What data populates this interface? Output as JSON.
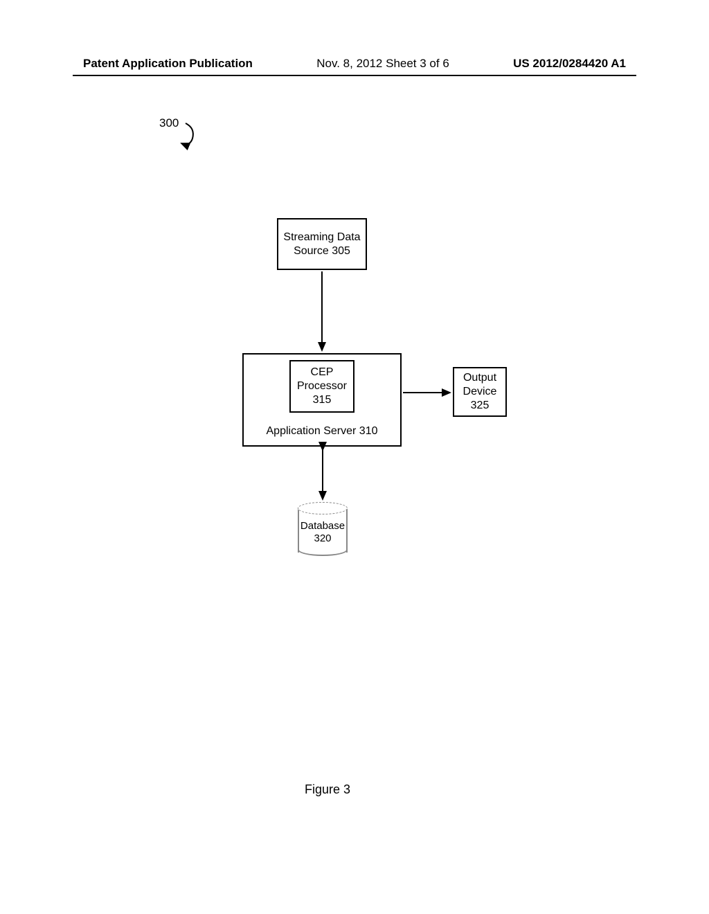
{
  "header": {
    "left": "Patent Application Publication",
    "center": "Nov. 8, 2012   Sheet 3 of 6",
    "right": "US 2012/0284420 A1"
  },
  "ref": {
    "diagramNumber": "300"
  },
  "boxes": {
    "source": {
      "line1": "Streaming Data",
      "line2": "Source 305"
    },
    "cep": {
      "line1": "CEP",
      "line2": "Processor",
      "line3": "315"
    },
    "appserver": {
      "label": "Application Server 310"
    },
    "output": {
      "line1": "Output",
      "line2": "Device",
      "line3": "325"
    },
    "database": {
      "line1": "Database",
      "line2": "320"
    }
  },
  "figure": {
    "caption": "Figure 3"
  }
}
